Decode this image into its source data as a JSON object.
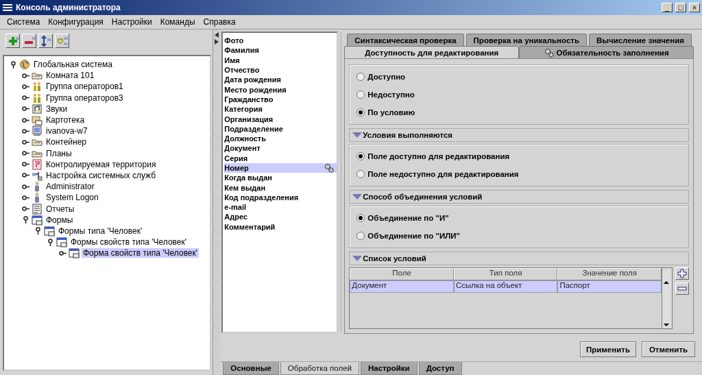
{
  "window": {
    "title": "Консоль администратора",
    "controls": [
      "_",
      "□",
      "×"
    ]
  },
  "menu": [
    "Система",
    "Конфигурация",
    "Настройки",
    "Команды",
    "Справка"
  ],
  "tree": [
    {
      "label": "Глобальная система",
      "kind": "globe",
      "expanded": true,
      "selected": false,
      "children": [
        {
          "label": "Комната 101",
          "kind": "folder",
          "expanded": false,
          "selected": false
        },
        {
          "label": "Группа операторов1",
          "kind": "group",
          "expanded": false,
          "selected": false
        },
        {
          "label": "Группа операторов3",
          "kind": "group",
          "expanded": false,
          "selected": false
        },
        {
          "label": "Звуки",
          "kind": "sound",
          "expanded": false,
          "selected": false
        },
        {
          "label": "Картотека",
          "kind": "cards",
          "expanded": false,
          "selected": false
        },
        {
          "label": "ivanova-w7",
          "kind": "computer",
          "expanded": false,
          "selected": false
        },
        {
          "label": "Контейнер",
          "kind": "folder",
          "expanded": false,
          "selected": false
        },
        {
          "label": "Планы",
          "kind": "folder",
          "expanded": false,
          "selected": false
        },
        {
          "label": "Контролируемая территория",
          "kind": "territory",
          "expanded": false,
          "selected": false
        },
        {
          "label": "Настройка системных служб",
          "kind": "services",
          "expanded": false,
          "selected": false
        },
        {
          "label": "Administrator",
          "kind": "user",
          "expanded": false,
          "selected": false
        },
        {
          "label": "System Logon",
          "kind": "user",
          "expanded": false,
          "selected": false
        },
        {
          "label": "Отчеты",
          "kind": "report",
          "expanded": false,
          "selected": false
        },
        {
          "label": "Формы",
          "kind": "form",
          "expanded": true,
          "selected": false,
          "children": [
            {
              "label": "Формы типа 'Человек'",
              "kind": "form",
              "expanded": true,
              "selected": false,
              "children": [
                {
                  "label": "Формы свойств типа 'Человек'",
                  "kind": "form",
                  "expanded": true,
                  "selected": false,
                  "children": [
                    {
                      "label": "Форма свойств типа 'Человек'",
                      "kind": "form",
                      "expanded": false,
                      "selected": true
                    }
                  ]
                }
              ]
            }
          ]
        }
      ]
    }
  ],
  "fields": [
    {
      "label": "Фото",
      "selected": false,
      "configured": false
    },
    {
      "label": "Фамилия",
      "selected": false,
      "configured": false
    },
    {
      "label": "Имя",
      "selected": false,
      "configured": false
    },
    {
      "label": "Отчество",
      "selected": false,
      "configured": false
    },
    {
      "label": "Дата рождения",
      "selected": false,
      "configured": false
    },
    {
      "label": "Место рождения",
      "selected": false,
      "configured": false
    },
    {
      "label": "Гражданство",
      "selected": false,
      "configured": false
    },
    {
      "label": "Категория",
      "selected": false,
      "configured": false
    },
    {
      "label": "Организация",
      "selected": false,
      "configured": false
    },
    {
      "label": "Подразделение",
      "selected": false,
      "configured": false
    },
    {
      "label": "Должность",
      "selected": false,
      "configured": false
    },
    {
      "label": "Документ",
      "selected": false,
      "configured": false
    },
    {
      "label": "Серия",
      "selected": false,
      "configured": false
    },
    {
      "label": "Номер",
      "selected": true,
      "configured": true
    },
    {
      "label": "Когда выдан",
      "selected": false,
      "configured": false
    },
    {
      "label": "Кем выдан",
      "selected": false,
      "configured": false
    },
    {
      "label": "Код подразделения",
      "selected": false,
      "configured": false
    },
    {
      "label": "e-mail",
      "selected": false,
      "configured": false
    },
    {
      "label": "Адрес",
      "selected": false,
      "configured": false
    },
    {
      "label": "Комментарий",
      "selected": false,
      "configured": false
    }
  ],
  "rule_tabs": [
    [
      {
        "label": "Синтаксическая проверка",
        "selected": false,
        "configured": false
      },
      {
        "label": "Проверка на уникальность",
        "selected": false,
        "configured": false
      },
      {
        "label": "Вычисление значения",
        "selected": false,
        "configured": false
      }
    ],
    [
      {
        "label": "Доступность для редактирования",
        "selected": true,
        "configured": false
      },
      {
        "label": "Обязательность заполнения",
        "selected": false,
        "configured": true
      }
    ]
  ],
  "availability": [
    {
      "label": "Доступно",
      "selected": false
    },
    {
      "label": "Недоступно",
      "selected": false
    },
    {
      "label": "По условию",
      "selected": true
    }
  ],
  "sections": [
    {
      "title": "Условия выполняются",
      "expanded": true,
      "kind": "radios",
      "options": [
        {
          "label": "Поле доступно для редактирования",
          "selected": true
        },
        {
          "label": "Поле недоступно для редактирования",
          "selected": false
        }
      ]
    },
    {
      "title": "Способ объединения условий",
      "expanded": true,
      "kind": "radios",
      "options": [
        {
          "label": "Объединение по \"И\"",
          "selected": true
        },
        {
          "label": "Объединение по \"ИЛИ\"",
          "selected": false
        }
      ]
    },
    {
      "title": "Список условий",
      "expanded": true,
      "kind": "table",
      "columns": [
        "Поле",
        "Тип поля",
        "Значение поля"
      ],
      "rows": [
        {
          "cells": [
            "Документ",
            "Ссылка на объект",
            "Паспорт"
          ],
          "selected": true
        }
      ]
    }
  ],
  "buttons": [
    "Применить",
    "Отменить"
  ],
  "bottom_tabs": [
    {
      "label": "Основные",
      "selected": false
    },
    {
      "label": "Обработка полей",
      "selected": true
    },
    {
      "label": "Настройки",
      "selected": false
    },
    {
      "label": "Доступ",
      "selected": false
    }
  ]
}
